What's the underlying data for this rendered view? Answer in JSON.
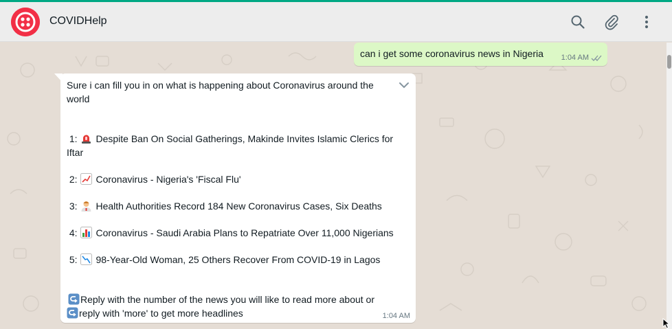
{
  "header": {
    "contact_name": "COVIDHelp",
    "avatar_icon": "twilio-logo-icon",
    "search_icon": "search-icon",
    "attach_icon": "paperclip-icon",
    "menu_icon": "kebab-menu-icon"
  },
  "messages": {
    "outgoing": {
      "text": "can i get some coronavirus news in Nigeria",
      "time": "1:04 AM",
      "status_icon": "double-check-icon"
    },
    "incoming": {
      "intro_line1": "Sure i can fill you in on what is happening about Coronavirus around the",
      "intro_line2": "world",
      "items": [
        {
          "num": "1:",
          "emoji": "rotating-light-icon",
          "line1": " Despite Ban On Social Gatherings, Makinde Invites Islamic Clerics for",
          "line2": "Iftar"
        },
        {
          "num": "2:",
          "emoji": "chart-increasing-icon",
          "line1": " Coronavirus - Nigeria's 'Fiscal Flu'"
        },
        {
          "num": "3:",
          "emoji": "health-worker-icon",
          "line1": " Health Authorities Record 184 New Coronavirus Cases, Six Deaths"
        },
        {
          "num": "4:",
          "emoji": "bar-chart-icon",
          "line1": " Coronavirus - Saudi Arabia Plans to Repatriate Over 11,000 Nigerians"
        },
        {
          "num": "5:",
          "emoji": "chart-decreasing-icon",
          "line1": " 98-Year-Old Woman, 25 Others Recover From COVID-19 in Lagos"
        }
      ],
      "reply_line1": "Reply with the number of the news you will like to read more about or",
      "reply_line2": "reply with 'more' to get more headlines",
      "reply_icon": "left-arrow-curving-right-icon",
      "time": "1:04 AM",
      "chevron_icon": "chevron-down-icon"
    }
  },
  "colors": {
    "outgoing_bubble": "#dcf8c6",
    "incoming_bubble": "#ffffff",
    "chat_background": "#e5ddd5",
    "avatar": "#f22f46"
  }
}
